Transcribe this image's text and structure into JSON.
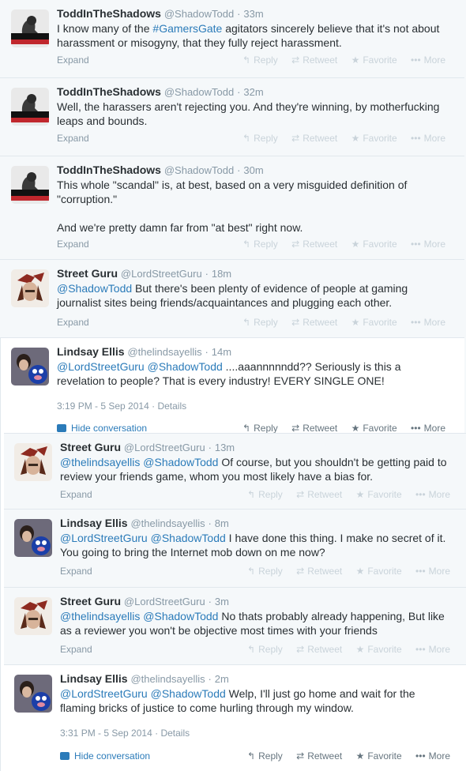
{
  "labels": {
    "expand": "Expand",
    "reply": "Reply",
    "retweet": "Retweet",
    "favorite": "Favorite",
    "more": "More",
    "details": "Details",
    "hide_conversation": "Hide conversation",
    "dot": "·"
  },
  "tweets": [
    {
      "fullname": "ToddInTheShadows",
      "username": "@ShadowTodd",
      "time": "33m",
      "text_before": "I know many of the ",
      "link": "#GamersGate",
      "text_after": " agitators sincerely believe that it's not about harassment or misogyny, that they fully reject harassment."
    },
    {
      "fullname": "ToddInTheShadows",
      "username": "@ShadowTodd",
      "time": "32m",
      "text": "Well, the harassers aren't rejecting you. And they're winning, by motherfucking leaps and bounds."
    },
    {
      "fullname": "ToddInTheShadows",
      "username": "@ShadowTodd",
      "time": "30m",
      "text": "This whole \"scandal\" is, at best, based on a very misguided definition of \"corruption.\"\n\nAnd we're pretty damn far from \"at best\" right now."
    },
    {
      "fullname": "Street Guru",
      "username": "@LordStreetGuru",
      "time": "18m",
      "mention": "@ShadowTodd",
      "text": " But there's been plenty of evidence of people at gaming journalist sites being friends/acquaintances and plugging each other."
    },
    {
      "fullname": "Lindsay Ellis",
      "username": "@thelindsayellis",
      "time": "14m",
      "mention1": "@LordStreetGuru",
      "mention2": "@ShadowTodd",
      "text": " ....aaannnnndd?? Seriously is this a revelation to people? That is every industry! EVERY SINGLE ONE!",
      "timestamp": "3:19 PM - 5 Sep 2014"
    },
    {
      "fullname": "Street Guru",
      "username": "@LordStreetGuru",
      "time": "13m",
      "mention1": "@thelindsayellis",
      "mention2": "@ShadowTodd",
      "text": " Of course, but you shouldn't be getting paid to review your friends game, whom you most likely have a bias for."
    },
    {
      "fullname": "Lindsay Ellis",
      "username": "@thelindsayellis",
      "time": "8m",
      "mention1": "@LordStreetGuru",
      "mention2": "@ShadowTodd",
      "text": " I have done this thing. I make no secret of it. You going to bring the Internet mob down on me now?"
    },
    {
      "fullname": "Street Guru",
      "username": "@LordStreetGuru",
      "time": "3m",
      "mention1": "@thelindsayellis",
      "mention2": "@ShadowTodd",
      "text": " No thats probably already happening, But like as a reviewer you won't be objective most times with your friends"
    },
    {
      "fullname": "Lindsay Ellis",
      "username": "@thelindsayellis",
      "time": "2m",
      "mention1": "@LordStreetGuru",
      "mention2": "@ShadowTodd",
      "text": " Welp, I'll just go home and wait for the flaming bricks of justice to come hurling through my window.",
      "timestamp": "3:31 PM - 5 Sep 2014"
    }
  ],
  "colors": {
    "link": "#2b7bb9",
    "background_collapsed": "#f5f8fa",
    "background_expanded": "#ffffff"
  }
}
